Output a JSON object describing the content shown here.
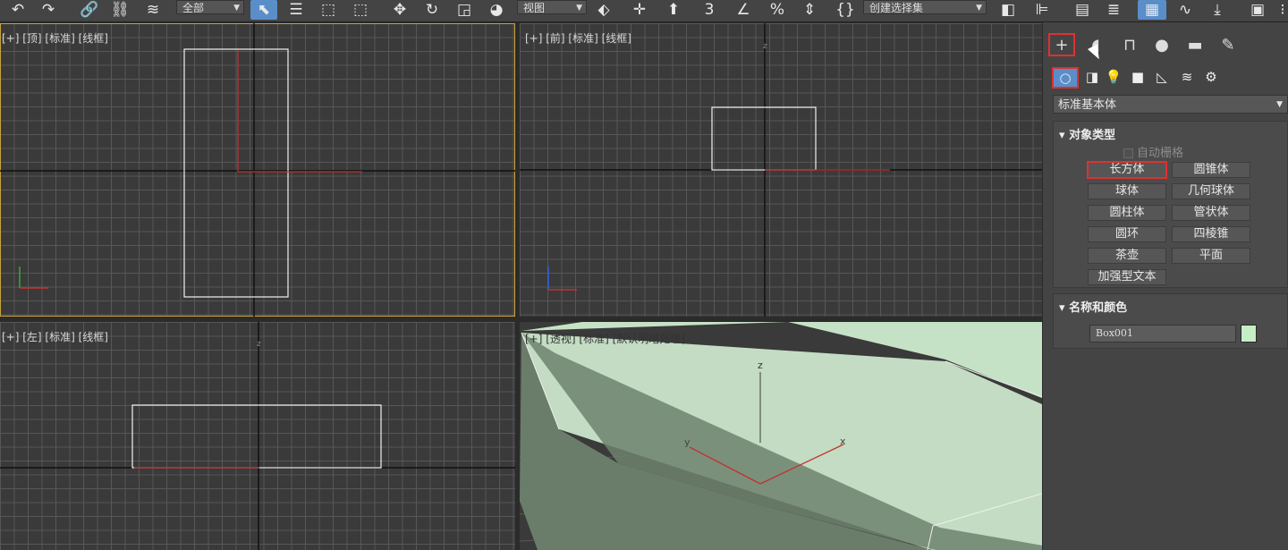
{
  "toolbar": {
    "selection_filter": "全部",
    "ref_coord": "视图",
    "named_selection": "创建选择集"
  },
  "viewports": {
    "top": {
      "label": "[+] [顶] [标准] [线框]"
    },
    "front": {
      "label": "[+] [前] [标准] [线框]"
    },
    "left": {
      "label": "[+] [左] [标准] [线框]"
    },
    "perspective": {
      "label": "[+] [透视] [标准] [默认明暗处理]"
    }
  },
  "axis": {
    "x": "x",
    "y": "y",
    "z": "z"
  },
  "command_panel": {
    "category": "标准基本体",
    "object_type": {
      "title": "对象类型",
      "auto_grid": "自动栅格",
      "buttons": [
        "长方体",
        "圆锥体",
        "球体",
        "几何球体",
        "圆柱体",
        "管状体",
        "圆环",
        "四棱锥",
        "茶壶",
        "平面",
        "加强型文本"
      ],
      "selected": "长方体"
    },
    "name_color": {
      "title": "名称和颜色",
      "name": "Box001",
      "color": "#c6edc6"
    }
  },
  "colors": {
    "highlight": "#e03030",
    "viewport_bg": "#3a3a3a",
    "box_face": "#c6e2c6",
    "active_border": "#c9a23a"
  }
}
